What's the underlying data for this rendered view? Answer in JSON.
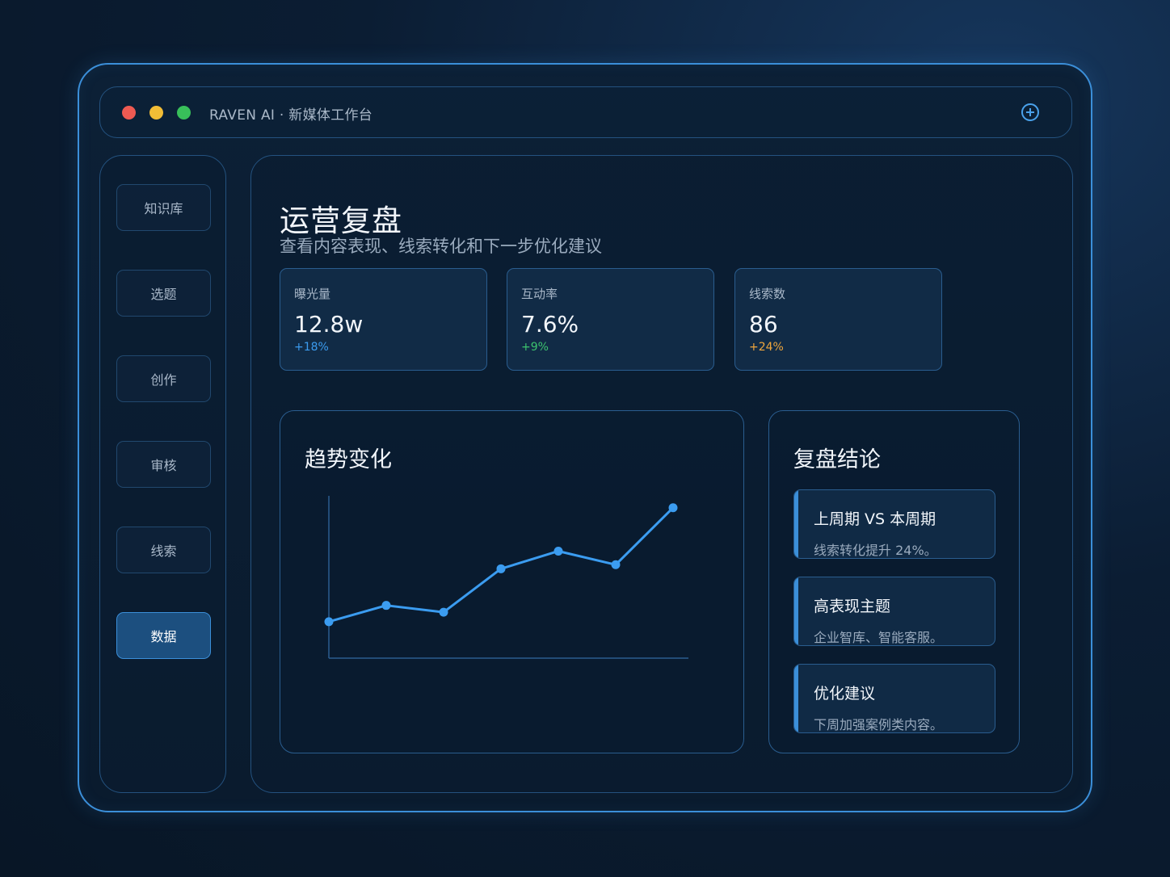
{
  "app": {
    "title": "RAVEN AI · 新媒体工作台"
  },
  "window_controls": [
    "close",
    "minimize",
    "maximize"
  ],
  "header_action": {
    "icon": "plus-circle-icon"
  },
  "sidebar": {
    "items": [
      {
        "label": "知识库",
        "active": false
      },
      {
        "label": "选题",
        "active": false
      },
      {
        "label": "创作",
        "active": false
      },
      {
        "label": "审核",
        "active": false
      },
      {
        "label": "线索",
        "active": false
      },
      {
        "label": "数据",
        "active": true
      }
    ]
  },
  "page": {
    "title": "运营复盘",
    "subtitle": "查看内容表现、线索转化和下一步优化建议"
  },
  "kpis": [
    {
      "label": "曝光量",
      "value": "12.8w",
      "delta": "+18%",
      "delta_color": "#3b9cf0"
    },
    {
      "label": "互动率",
      "value": "7.6%",
      "delta": "+9%",
      "delta_color": "#3cc46e"
    },
    {
      "label": "线索数",
      "value": "86",
      "delta": "+24%",
      "delta_color": "#f0a63c"
    }
  ],
  "trend": {
    "title": "趋势变化"
  },
  "chart_data": {
    "type": "line",
    "title": "趋势变化",
    "x": [
      1,
      2,
      3,
      4,
      5,
      6,
      7
    ],
    "series": [
      {
        "values": [
          12,
          24,
          19,
          51,
          64,
          54,
          96
        ]
      }
    ],
    "ylim": [
      0,
      100
    ],
    "grid": false,
    "color": "#3b9cf0"
  },
  "conclusion": {
    "title": "复盘结论",
    "cards": [
      {
        "title": "上周期 VS 本周期",
        "text": "线索转化提升 24%。"
      },
      {
        "title": "高表现主题",
        "text": "企业智库、智能客服。"
      },
      {
        "title": "优化建议",
        "text": "下周加强案例类内容。"
      }
    ]
  },
  "colors": {
    "accent": "#3b8fd9",
    "background": "#0b1d33",
    "line": "#3b9cf0"
  }
}
